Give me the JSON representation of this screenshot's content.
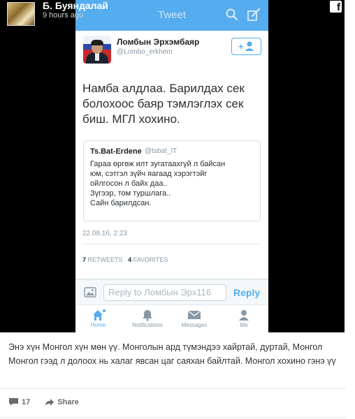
{
  "facebook": {
    "author": "Б. Буяндалай",
    "timestamp": "9 hours ago",
    "logo": "f"
  },
  "twitter": {
    "topbar_title": "Tweet",
    "tweet": {
      "author_name": "Ломбын Эрхэмбаяр",
      "author_handle": "@Lombo_erkhem",
      "text": "Намба алдлаа. Барилдах сек\nболохоос баяр тэмлэглэх сек\nбиш. МГЛ хохино.",
      "quote": {
        "author": "Ts.Bat-Erdene",
        "handle": "@tsbat_IT",
        "text": "Гараа өргөж илт зугатаахгүй л байсан\nюм, сэтгэл зүйч яагаад хэрэгтэйг\nойлгосон л байх даа..\nЗүгээр, том туршлага..\nСайн барилдсан."
      },
      "date": "22.08.16, 2:23",
      "retweets_count": "7",
      "retweets_label": "RETWEETS",
      "favorites_count": "4",
      "favorites_label": "FAVORITES"
    },
    "reply": {
      "placeholder": "Reply to Ломбын Эрх",
      "char_count": "116",
      "button": "Reply"
    },
    "tabs": [
      {
        "label": "Home",
        "icon": "home-icon"
      },
      {
        "label": "Notifications",
        "icon": "bell-icon"
      },
      {
        "label": "Messages",
        "icon": "envelope-icon"
      },
      {
        "label": "Me",
        "icon": "person-icon"
      }
    ],
    "colors": {
      "brand": "#55acee"
    }
  },
  "post": {
    "caption": "Энэ хүн Монгол хүн мөн үү. Монголын ард түмэндээ хайртай, дуртай, Монгол Монгол гээд л долоох нь халаг явсан цаг саяхан байлтай. Монгол хохино гэнэ үү",
    "comment_count": "17",
    "share_label": "Share"
  }
}
